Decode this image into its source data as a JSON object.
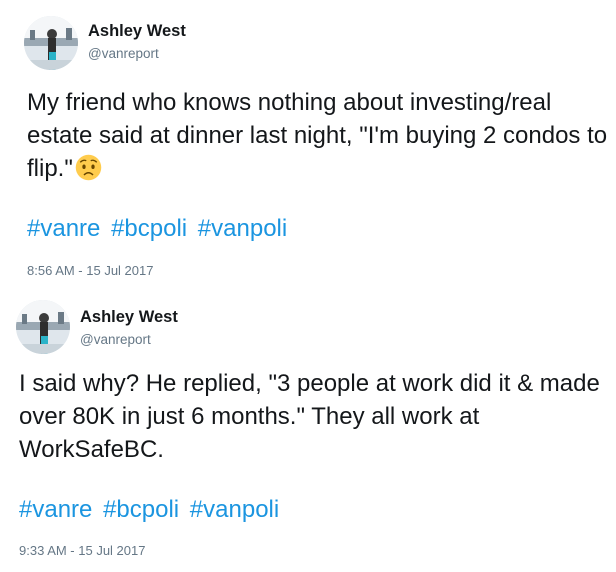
{
  "tweets": [
    {
      "author_name": "Ashley West",
      "author_handle": "@vanreport",
      "text": "My friend who knows nothing about investing/real estate said at dinner last night, \"I'm buying 2 condos to flip.\"",
      "emoji": "worried-face",
      "hashtags": [
        "#vanre",
        "#bcpoli",
        "#vanpoli"
      ],
      "timestamp": "8:56 AM - 15 Jul 2017"
    },
    {
      "author_name": "Ashley West",
      "author_handle": "@vanreport",
      "text": "I said why? He replied, \"3 people at work did it & made over 80K in just 6 months.\" They all work at WorkSafeBC.",
      "hashtags": [
        "#vanre",
        "#bcpoli",
        "#vanpoli"
      ],
      "timestamp": "9:33 AM - 15 Jul 2017"
    }
  ],
  "colors": {
    "hashtag": "#1b95e0",
    "meta_gray": "#657786",
    "text": "#14171a"
  }
}
